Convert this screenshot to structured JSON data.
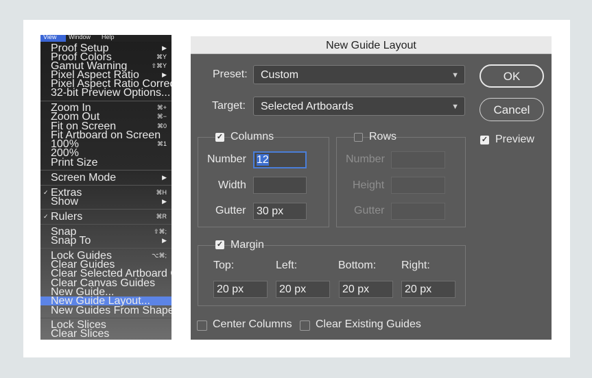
{
  "menubar": {
    "view": "View",
    "window": "Window",
    "help": "Help"
  },
  "menu": {
    "items": [
      {
        "label": "Proof Setup",
        "shortcut": "▶"
      },
      {
        "label": "Proof Colors",
        "shortcut": "⌘Y"
      },
      {
        "label": "Gamut Warning",
        "shortcut": "⇧⌘Y"
      },
      {
        "label": "Pixel Aspect Ratio",
        "shortcut": "▶"
      },
      {
        "label": "Pixel Aspect Ratio Correction",
        "shortcut": ""
      },
      {
        "label": "32-bit Preview Options...",
        "shortcut": ""
      },
      {
        "label": "Zoom In",
        "shortcut": "⌘+"
      },
      {
        "label": "Zoom Out",
        "shortcut": "⌘−"
      },
      {
        "label": "Fit on Screen",
        "shortcut": "⌘0"
      },
      {
        "label": "Fit Artboard on Screen",
        "shortcut": ""
      },
      {
        "label": "100%",
        "shortcut": "⌘1"
      },
      {
        "label": "200%",
        "shortcut": ""
      },
      {
        "label": "Print Size",
        "shortcut": ""
      },
      {
        "label": "Screen Mode",
        "shortcut": "▶"
      },
      {
        "label": "Extras",
        "shortcut": "⌘H",
        "check": "✓"
      },
      {
        "label": "Show",
        "shortcut": "▶"
      },
      {
        "label": "Rulers",
        "shortcut": "⌘R",
        "check": "✓"
      },
      {
        "label": "Snap",
        "shortcut": "⇧⌘;"
      },
      {
        "label": "Snap To",
        "shortcut": "▶"
      },
      {
        "label": "Lock Guides",
        "shortcut": "⌥⌘;"
      },
      {
        "label": "Clear Guides",
        "shortcut": ""
      },
      {
        "label": "Clear Selected Artboard Guides",
        "shortcut": ""
      },
      {
        "label": "Clear Canvas Guides",
        "shortcut": ""
      },
      {
        "label": "New Guide...",
        "shortcut": ""
      },
      {
        "label": "New Guide Layout...",
        "shortcut": ""
      },
      {
        "label": "New Guides From Shape",
        "shortcut": ""
      },
      {
        "label": "Lock Slices",
        "shortcut": ""
      },
      {
        "label": "Clear Slices",
        "shortcut": ""
      }
    ]
  },
  "dialog": {
    "title": "New Guide Layout",
    "preset_label": "Preset:",
    "preset_value": "Custom",
    "target_label": "Target:",
    "target_value": "Selected Artboards",
    "ok": "OK",
    "cancel": "Cancel",
    "preview": "Preview",
    "columns": {
      "title": "Columns",
      "number_label": "Number",
      "number_value": "12",
      "width_label": "Width",
      "width_value": "",
      "gutter_label": "Gutter",
      "gutter_value": "30 px"
    },
    "rows": {
      "title": "Rows",
      "number_label": "Number",
      "height_label": "Height",
      "gutter_label": "Gutter"
    },
    "margin": {
      "title": "Margin",
      "top_label": "Top:",
      "left_label": "Left:",
      "bottom_label": "Bottom:",
      "right_label": "Right:",
      "top": "20 px",
      "left": "20 px",
      "bottom": "20 px",
      "right": "20 px"
    },
    "center_columns": "Center Columns",
    "clear_existing": "Clear Existing Guides"
  },
  "colors": {
    "highlight": "#5c84e6",
    "dialog_bg": "#5a5a5a",
    "focus": "#4a7ed9"
  }
}
